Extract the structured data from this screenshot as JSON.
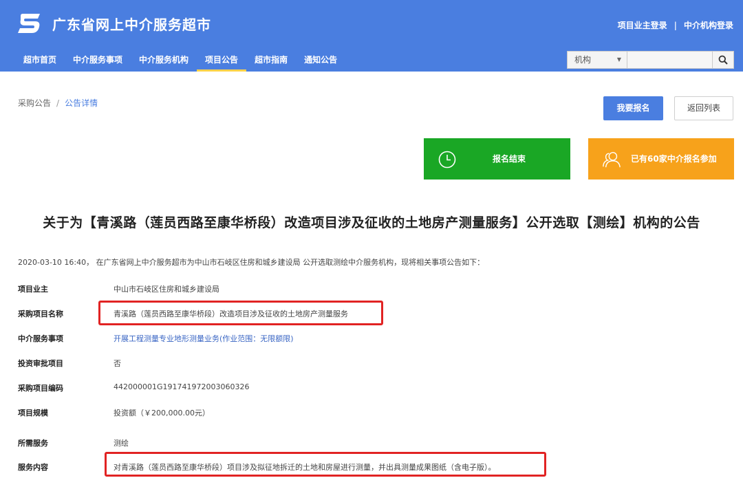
{
  "header": {
    "site_title": "广东省网上中介服务超市",
    "owner_login": "项目业主登录",
    "separator": "|",
    "agency_login": "中介机构登录",
    "brand_color": "#4a7ee0"
  },
  "nav": {
    "items": [
      {
        "label": "超市首页"
      },
      {
        "label": "中介服务事项"
      },
      {
        "label": "中介服务机构"
      },
      {
        "label": "项目公告",
        "active": true
      },
      {
        "label": "超市指南"
      },
      {
        "label": "通知公告"
      }
    ]
  },
  "search": {
    "select_value": "机构",
    "input_value": "",
    "button_icon": "search-icon"
  },
  "breadcrumb": {
    "parent": "采购公告",
    "separator": "/",
    "current": "公告详情"
  },
  "actions": {
    "apply_label": "我要报名",
    "back_label": "返回列表"
  },
  "status_cards": {
    "registration": {
      "label": "报名结束",
      "icon": "clock-icon",
      "color": "#1aa725"
    },
    "participants": {
      "label": "已有60家中介报名参加",
      "icon": "users-icon",
      "color": "#f7a21b"
    }
  },
  "announcement": {
    "title": "关于为【青溪路（莲员西路至康华桥段）改造项目涉及征收的土地房产测量服务】公开选取【测绘】机构的公告",
    "intro": "2020-03-10 16:40， 在广东省网上中介服务超市为中山市石岐区住房和城乡建设局 公开选取测绘中介服务机构，现将相关事项公告如下：",
    "fields": [
      {
        "label": "项目业主",
        "value": "中山市石岐区住房和城乡建设局"
      },
      {
        "label": "采购项目名称",
        "value": "青溪路（莲员西路至康华桥段）改造项目涉及征收的土地房产测量服务",
        "highlighted": true
      },
      {
        "label": "中介服务事项",
        "value": "开展工程测量专业地形测量业务(作业范围：无限额限)",
        "link": true
      },
      {
        "label": "投资审批项目",
        "value": "否"
      },
      {
        "label": "采购项目编码",
        "value": "442000001G191741972003060326"
      },
      {
        "label": "项目规模",
        "value": "投资额（￥200,000.00元）"
      },
      {
        "label": "所需服务",
        "value": "测绘"
      },
      {
        "label": "服务内容",
        "value": "对青溪路（莲员西路至康华桥段）项目涉及拟征地拆迁的土地和房屋进行测量，并出具测量成果图纸（含电子版）。",
        "highlighted": true
      }
    ]
  }
}
